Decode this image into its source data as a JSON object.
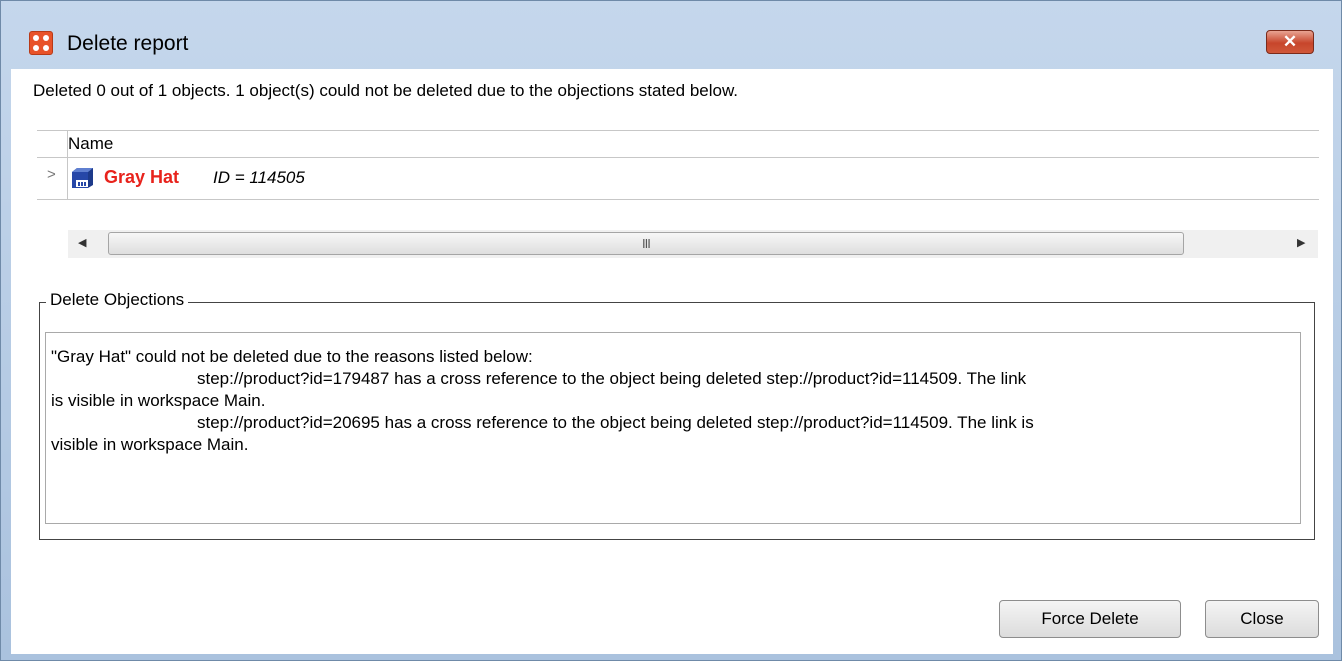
{
  "window": {
    "title": "Delete report",
    "close_glyph": "✕"
  },
  "summary": "Deleted 0 out of 1 objects. 1 object(s) could not be deleted due to the objections stated below.",
  "grid": {
    "column_header": "Name",
    "rows": [
      {
        "name": "Gray Hat",
        "id_text": "ID = 114505",
        "icon": "product-icon"
      }
    ]
  },
  "objections": {
    "legend": "Delete Objections",
    "lines": [
      "\"Gray Hat\" could not be deleted due to the reasons listed below:",
      "step://product?id=179487 has a cross reference to the object being deleted step://product?id=114509. The link",
      "is visible in workspace Main.",
      "step://product?id=20695 has a cross reference to the object being deleted step://product?id=114509. The link is",
      "visible in workspace Main."
    ]
  },
  "buttons": {
    "force_delete": "Force Delete",
    "close": "Close"
  },
  "colors": {
    "title_bar": "#c5d7ec",
    "close_button": "#c7452b",
    "row_name": "#e8231c",
    "app_icon": "#e8532a"
  }
}
